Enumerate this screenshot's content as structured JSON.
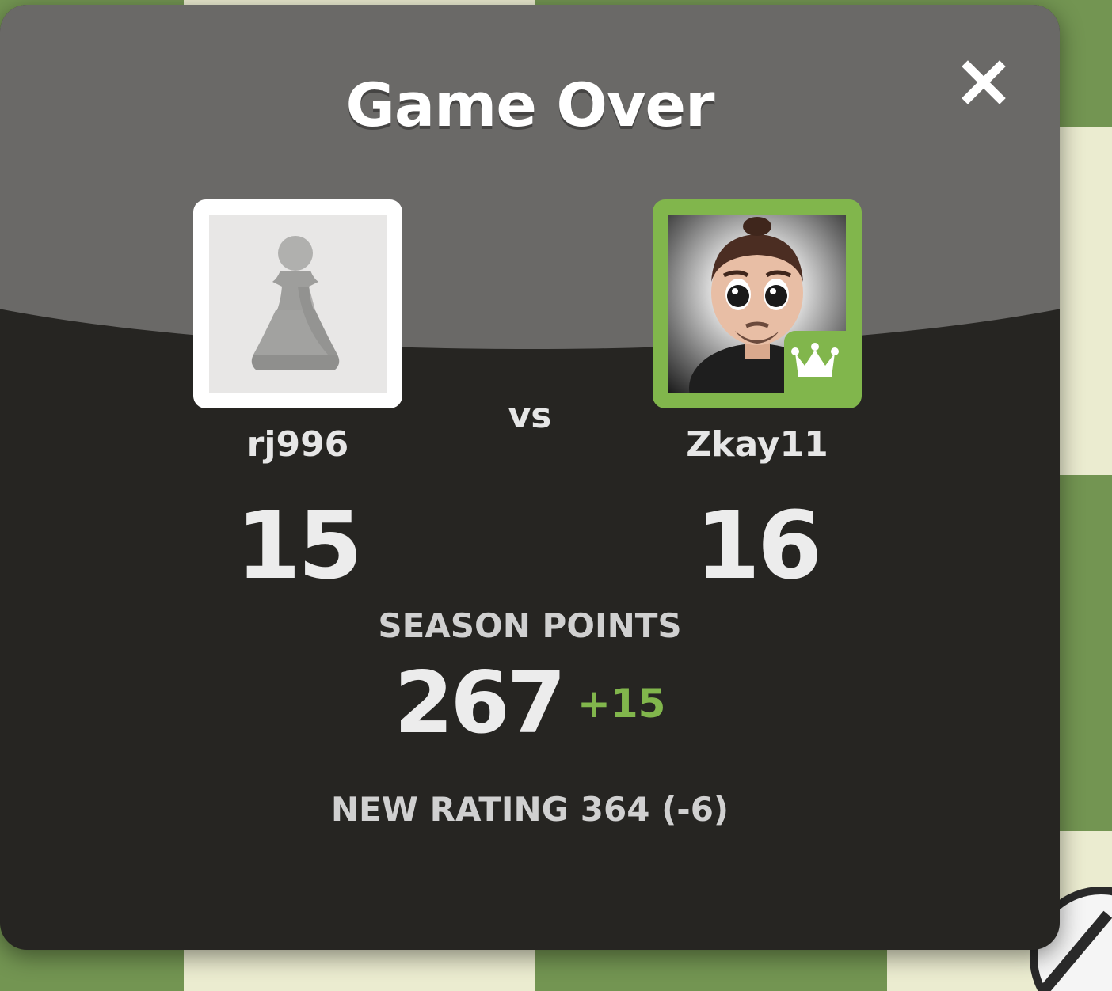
{
  "modal": {
    "title": "Game Over",
    "close_icon": "close-icon",
    "vs_label": "vs"
  },
  "players": [
    {
      "username": "rj996",
      "score": "15",
      "avatar": "pawn-avatar-icon"
    },
    {
      "username": "Zkay11",
      "score": "16",
      "avatar": "profile-avatar",
      "badge": "crown-icon"
    }
  ],
  "season": {
    "label": "SEASON POINTS",
    "value": "267",
    "delta": "+15"
  },
  "rating": {
    "text": "NEW RATING 364 (-6)"
  },
  "colors": {
    "accent_green": "#81b64c",
    "panel_dark": "#262522",
    "header_gray": "#6a6967"
  }
}
